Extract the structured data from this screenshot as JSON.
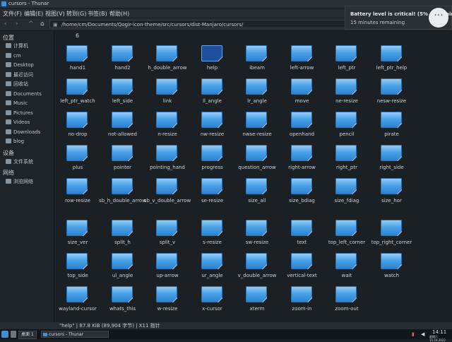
{
  "window": {
    "title": "cursors - Thunar"
  },
  "menu": [
    "文件(F)",
    "编辑(E)",
    "视图(V)",
    "转到(G)",
    "书签(B)",
    "帮助(H)"
  ],
  "toolbar": {
    "path": "/home/cm/Documents/Qogir-icon-theme/src/cursors/dist-Manjaro/cursors/"
  },
  "sidebar": {
    "devices_header": "位置",
    "places": [
      "计算机",
      "cm",
      "Desktop",
      "最近访问",
      "回收站",
      "Documents",
      "Music",
      "Pictures",
      "Videos",
      "Downloads",
      "blog"
    ],
    "section2": "设备",
    "devices": [
      "文件系统"
    ],
    "section3": "网络",
    "network": [
      "浏览网络"
    ]
  },
  "main": {
    "top_label": "6",
    "items": [
      "hand1",
      "hand2",
      "h_double_arrow",
      "help",
      "ibeam",
      "left-arrow",
      "left_ptr",
      "left_ptr_help",
      "left_ptr_watch",
      "left_side",
      "link",
      "ll_angle",
      "lr_angle",
      "move",
      "ne-resize",
      "nesw-resize",
      "no-drop",
      "not-allowed",
      "n-resize",
      "nw-resize",
      "nwse-resize",
      "openhand",
      "pencil",
      "pirate",
      "plus",
      "pointer",
      "pointing_hand",
      "progress",
      "question_arrow",
      "right-arrow",
      "right_ptr",
      "right_side",
      "row-resize",
      "sb_h_double_arrow",
      "sb_v_double_arrow",
      "se-resize",
      "size_all",
      "size_bdiag",
      "size_fdiag",
      "size_hor",
      "size_ver",
      "split_h",
      "split_v",
      "s-resize",
      "sw-resize",
      "text",
      "top_left_corner",
      "top_right_corner",
      "top_side",
      "ul_angle",
      "up-arrow",
      "ur_angle",
      "v_double_arrow",
      "vertical-text",
      "wait",
      "watch",
      "wayland-cursor",
      "whats_this",
      "w-resize",
      "x-cursor",
      "xterm",
      "zoom-in",
      "zoom-out"
    ],
    "selected": "help"
  },
  "status": {
    "text": "\"help\" | 87.8 KiB (89,904 字节) | X11 指针"
  },
  "taskbar": {
    "desktop": "桌面 1",
    "task": "cursors - Thunar",
    "clock": "14:11",
    "date": "星期六 15.10.2022"
  },
  "notification": {
    "title": "Battery level is critical! (5% remaining)",
    "body": "15 minutes remaining"
  }
}
